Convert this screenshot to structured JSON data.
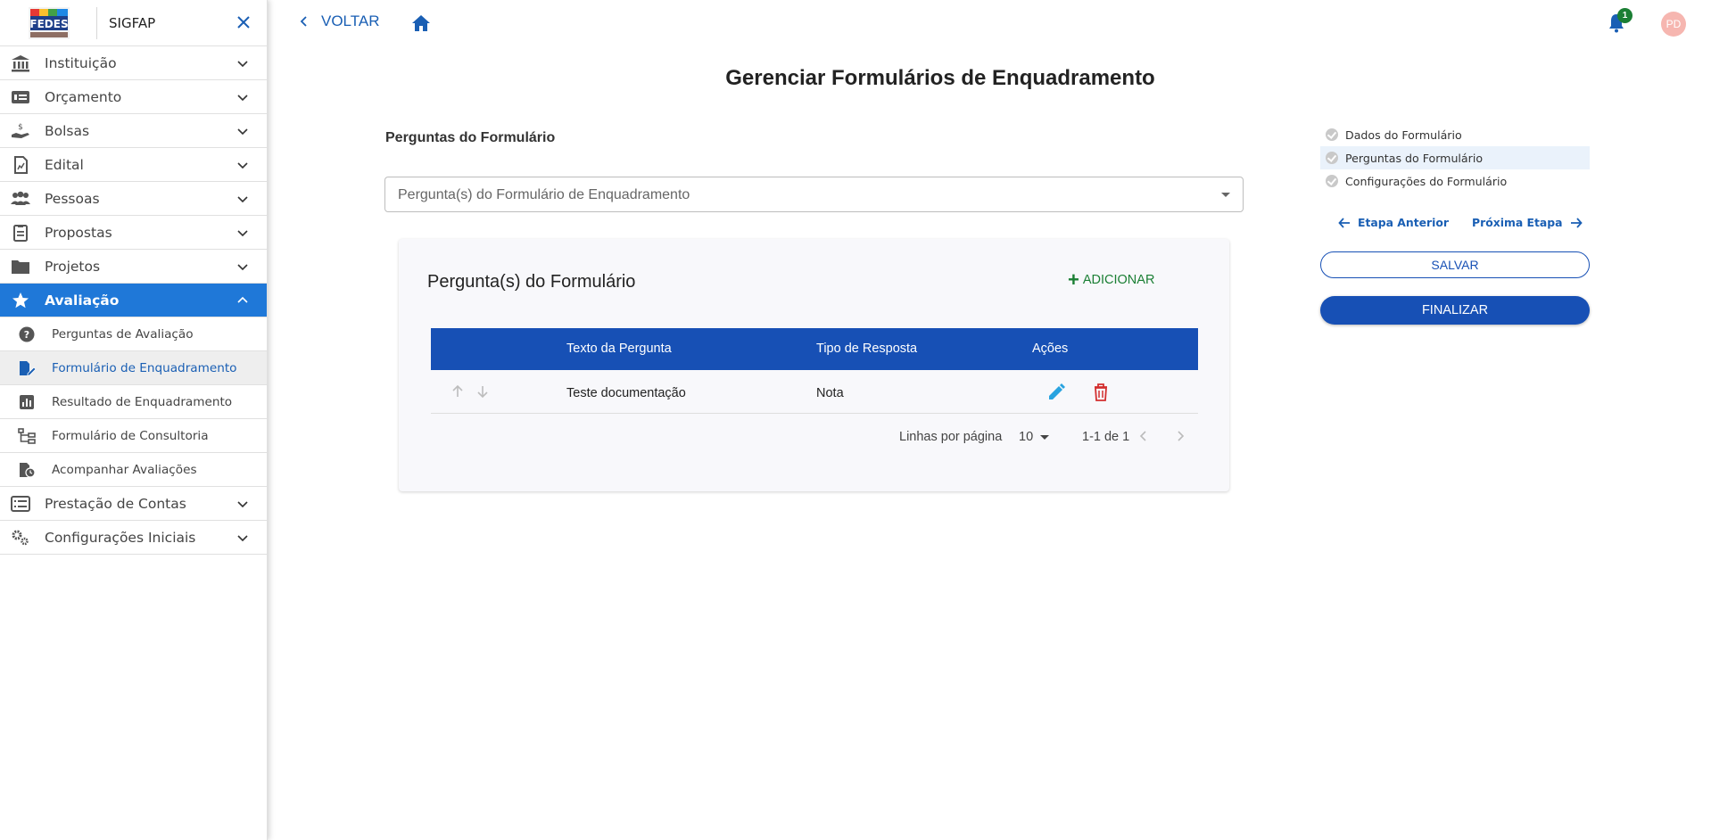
{
  "app": {
    "name": "SIGFAP",
    "logo_text": "FEDES"
  },
  "sidebar": {
    "items": [
      {
        "label": "Instituição",
        "icon": "bank-icon",
        "expanded": false
      },
      {
        "label": "Orçamento",
        "icon": "money-card-icon",
        "expanded": false
      },
      {
        "label": "Bolsas",
        "icon": "hand-coin-icon",
        "expanded": false
      },
      {
        "label": "Edital",
        "icon": "document-chart-icon",
        "expanded": false
      },
      {
        "label": "Pessoas",
        "icon": "people-icon",
        "expanded": false
      },
      {
        "label": "Propostas",
        "icon": "clipboard-icon",
        "expanded": false
      },
      {
        "label": "Projetos",
        "icon": "folder-icon",
        "expanded": false
      },
      {
        "label": "Avaliação",
        "icon": "star-icon",
        "expanded": true,
        "active": true
      },
      {
        "label": "Prestação de Contas",
        "icon": "list-icon",
        "expanded": false
      },
      {
        "label": "Configurações Iniciais",
        "icon": "gears-icon",
        "expanded": false
      }
    ],
    "sub_items": [
      {
        "label": "Perguntas de Avaliação",
        "icon": "question-circle-icon"
      },
      {
        "label": "Formulário de Enquadramento",
        "icon": "document-edit-icon",
        "selected": true
      },
      {
        "label": "Resultado de Enquadramento",
        "icon": "bar-chart-icon"
      },
      {
        "label": "Formulário de Consultoria",
        "icon": "tree-structure-icon"
      },
      {
        "label": "Acompanhar Avaliações",
        "icon": "document-clock-icon"
      }
    ]
  },
  "topbar": {
    "back_label": "VOLTAR",
    "notification_count": "1",
    "avatar_initials": "PD"
  },
  "page": {
    "title": "Gerenciar Formulários de Enquadramento",
    "section_title": "Perguntas do Formulário",
    "select_placeholder": "Pergunta(s) do Formulário de Enquadramento"
  },
  "card": {
    "title": "Pergunta(s) do Formulário",
    "add_label": "ADICIONAR",
    "columns": [
      "Texto da Pergunta",
      "Tipo de Resposta",
      "Ações"
    ],
    "rows": [
      {
        "text": "Teste documentação",
        "type": "Nota"
      }
    ],
    "pagination": {
      "rows_per_page_label": "Linhas por página",
      "rows_per_page": "10",
      "range": "1-1 de 1"
    }
  },
  "stepper": {
    "steps": [
      {
        "label": "Dados do Formulário"
      },
      {
        "label": "Perguntas do Formulário",
        "current": true
      },
      {
        "label": "Configurações do Formulário"
      }
    ],
    "prev_label": "Etapa Anterior",
    "next_label": "Próxima Etapa",
    "save_label": "SALVAR",
    "finish_label": "FINALIZAR"
  },
  "colors": {
    "primary": "#1750b5",
    "sidebar_active": "#1f78d8",
    "add_green": "#1b7f34",
    "delete_red": "#d32f2f",
    "edit_blue": "#29a3e0"
  }
}
